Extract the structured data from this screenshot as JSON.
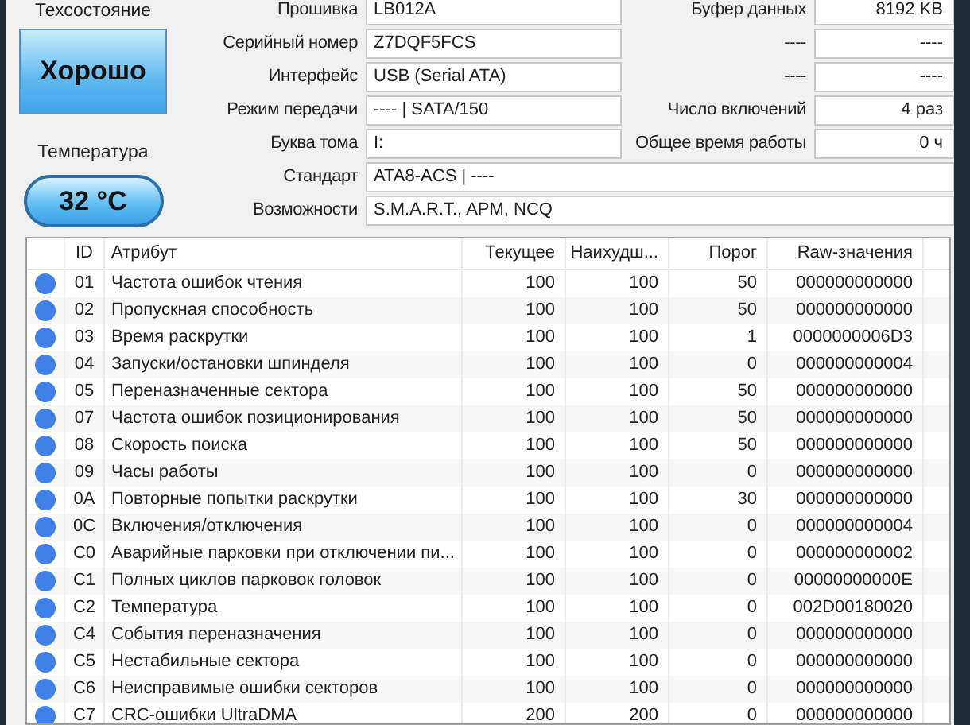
{
  "health": {
    "label": "Техсостояние",
    "value": "Хорошо"
  },
  "temperature": {
    "label": "Температура",
    "value": "32 °C"
  },
  "info": [
    {
      "label": "Прошивка",
      "value": "LB012A"
    },
    {
      "label": "Серийный номер",
      "value": "Z7DQF5FCS"
    },
    {
      "label": "Интерфейс",
      "value": "USB (Serial ATA)"
    },
    {
      "label": "Режим передачи",
      "value": "---- | SATA/150"
    },
    {
      "label": "Буква тома",
      "value": "I:"
    }
  ],
  "info_right": [
    {
      "label": "Буфер данных",
      "value": "8192 KB"
    },
    {
      "label": "----",
      "value": "----"
    },
    {
      "label": "----",
      "value": "----"
    },
    {
      "label": "Число включений",
      "value": "4 раз"
    },
    {
      "label": "Общее время работы",
      "value": "0 ч"
    }
  ],
  "info_wide": [
    {
      "label": "Стандарт",
      "value": "ATA8-ACS | ----"
    },
    {
      "label": "Возможности",
      "value": "S.M.A.R.T., APM, NCQ"
    }
  ],
  "table": {
    "columns": [
      "ID",
      "Атрибут",
      "Текущее",
      "Наихудш...",
      "Порог",
      "Raw-значения"
    ],
    "rows": [
      {
        "color": "#3f7fe6",
        "cells": [
          "01",
          "Частота ошибок чтения",
          "100",
          "100",
          "50",
          "000000000000"
        ]
      },
      {
        "color": "#3f7fe6",
        "cells": [
          "02",
          "Пропускная способность",
          "100",
          "100",
          "50",
          "000000000000"
        ]
      },
      {
        "color": "#3f7fe6",
        "cells": [
          "03",
          "Время раскрутки",
          "100",
          "100",
          "1",
          "0000000006D3"
        ]
      },
      {
        "color": "#3f7fe6",
        "cells": [
          "04",
          "Запуски/остановки шпинделя",
          "100",
          "100",
          "0",
          "000000000004"
        ]
      },
      {
        "color": "#3f7fe6",
        "cells": [
          "05",
          "Переназначенные сектора",
          "100",
          "100",
          "50",
          "000000000000"
        ]
      },
      {
        "color": "#3f7fe6",
        "cells": [
          "07",
          "Частота ошибок позиционирования",
          "100",
          "100",
          "50",
          "000000000000"
        ]
      },
      {
        "color": "#3f7fe6",
        "cells": [
          "08",
          "Скорость поиска",
          "100",
          "100",
          "50",
          "000000000000"
        ]
      },
      {
        "color": "#3f7fe6",
        "cells": [
          "09",
          "Часы работы",
          "100",
          "100",
          "0",
          "000000000000"
        ]
      },
      {
        "color": "#3f7fe6",
        "cells": [
          "0A",
          "Повторные попытки раскрутки",
          "100",
          "100",
          "30",
          "000000000000"
        ]
      },
      {
        "color": "#3f7fe6",
        "cells": [
          "0C",
          "Включения/отключения",
          "100",
          "100",
          "0",
          "000000000004"
        ]
      },
      {
        "color": "#3f7fe6",
        "cells": [
          "C0",
          "Аварийные парковки при отключении пи...",
          "100",
          "100",
          "0",
          "000000000002"
        ]
      },
      {
        "color": "#3f7fe6",
        "cells": [
          "C1",
          "Полных циклов парковок головок",
          "100",
          "100",
          "0",
          "00000000000E"
        ]
      },
      {
        "color": "#3f7fe6",
        "cells": [
          "C2",
          "Температура",
          "100",
          "100",
          "0",
          "002D00180020"
        ]
      },
      {
        "color": "#3f7fe6",
        "cells": [
          "C4",
          "События переназначения",
          "100",
          "100",
          "0",
          "000000000000"
        ]
      },
      {
        "color": "#3f7fe6",
        "cells": [
          "C5",
          "Нестабильные сектора",
          "100",
          "100",
          "0",
          "000000000000"
        ]
      },
      {
        "color": "#3f7fe6",
        "cells": [
          "C6",
          "Неисправимые ошибки секторов",
          "100",
          "100",
          "0",
          "000000000000"
        ]
      },
      {
        "color": "#3f7fe6",
        "cells": [
          "C7",
          "CRC-ошибки UltraDMA",
          "200",
          "200",
          "0",
          "000000000000"
        ]
      }
    ]
  }
}
